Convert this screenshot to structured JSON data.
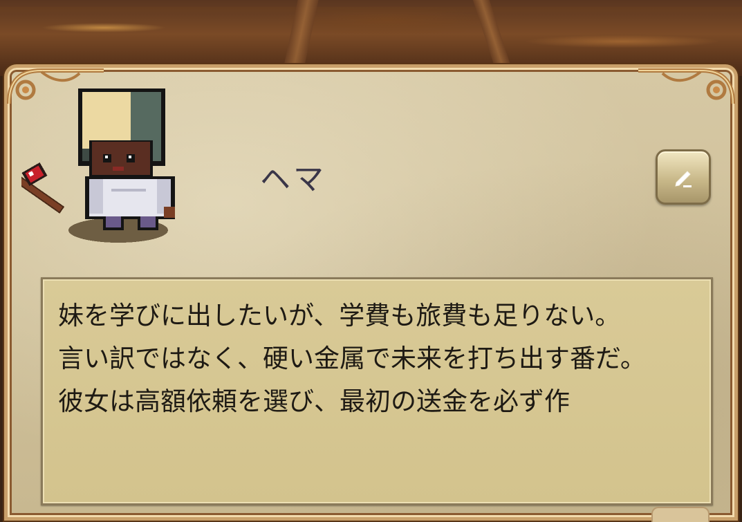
{
  "hero": {
    "name": "ヘマ",
    "avatar_icon": "pixel-blacksmith-girl-icon"
  },
  "edit": {
    "icon": "pencil-icon"
  },
  "story": {
    "text": "妹を学びに出したいが、学費も旅費も足りない。\n言い訳ではなく、硬い金属で未来を打ち出す番だ。\n彼女は高額依頼を選び、最初の送金を必ず作"
  },
  "colors": {
    "parchment": "#cfc09a",
    "text_box": "#d6c793",
    "frame_gold": "#c9a06a",
    "name_text": "#3a3648"
  }
}
